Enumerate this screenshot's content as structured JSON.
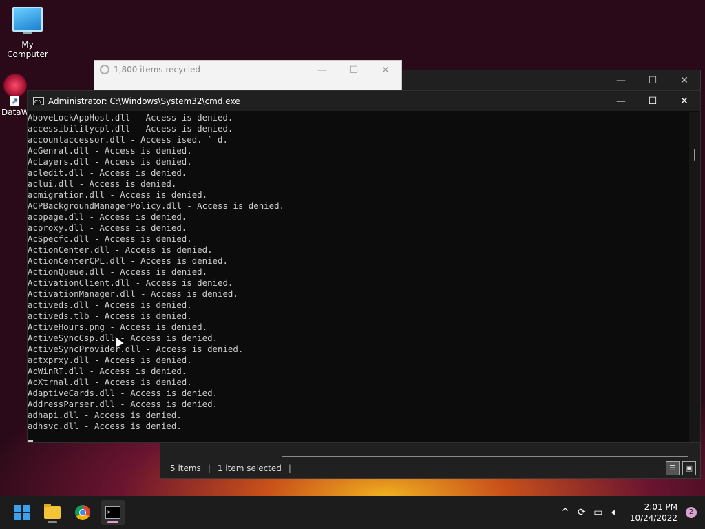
{
  "desktop": {
    "icons": [
      {
        "label": "My Computer"
      },
      {
        "label": "DataW"
      }
    ]
  },
  "explorer": {
    "status": {
      "items": "5 items",
      "selected": "1 item selected"
    },
    "controls": {
      "minimize": "—",
      "maximize": "☐",
      "close": "✕"
    }
  },
  "recycle_dialog": {
    "title": "1,800 items recycled",
    "controls": {
      "minimize": "—",
      "maximize": "☐",
      "close": "✕"
    }
  },
  "cmd": {
    "title": "Administrator:  C:\\Windows\\System32\\cmd.exe",
    "icon_text": "C:\\_",
    "controls": {
      "minimize": "—",
      "maximize": "☐",
      "close": "✕"
    },
    "lines": [
      "AboveLockAppHost.dll - Access is denied.",
      "accessibilitycpl.dll - Access is denied.",
      "accountaccessor.dll - Access ised. ` d.",
      "AcGenral.dll - Access is denied.",
      "AcLayers.dll - Access is denied.",
      "acledit.dll - Access is denied.",
      "aclui.dll - Access is denied.",
      "acmigration.dll - Access is denied.",
      "ACPBackgroundManagerPolicy.dll - Access is denied.",
      "acppage.dll - Access is denied.",
      "acproxy.dll - Access is denied.",
      "AcSpecfc.dll - Access is denied.",
      "ActionCenter.dll - Access is denied.",
      "ActionCenterCPL.dll - Access is denied.",
      "ActionQueue.dll - Access is denied.",
      "ActivationClient.dll - Access is denied.",
      "ActivationManager.dll - Access is denied.",
      "activeds.dll - Access is denied.",
      "activeds.tlb - Access is denied.",
      "ActiveHours.png - Access is denied.",
      "ActiveSyncCsp.dll - Access is denied.",
      "ActiveSyncProvider.dll - Access is denied.",
      "actxprxy.dll - Access is denied.",
      "AcWinRT.dll - Access is denied.",
      "AcXtrnal.dll - Access is denied.",
      "AdaptiveCards.dll - Access is denied.",
      "AddressParser.dll - Access is denied.",
      "adhapi.dll - Access is denied.",
      "adhsvc.dll - Access is denied."
    ]
  },
  "taskbar": {
    "apps": [
      {
        "name": "start",
        "icon": "windows-icon"
      },
      {
        "name": "file-explorer",
        "icon": "folder-icon"
      },
      {
        "name": "chrome",
        "icon": "chrome-icon"
      },
      {
        "name": "terminal",
        "icon": "cmd-icon",
        "label": ">_"
      }
    ],
    "tray": {
      "chevron": "^",
      "time": "2:01 PM",
      "date": "10/24/2022",
      "notifications": "2"
    }
  }
}
